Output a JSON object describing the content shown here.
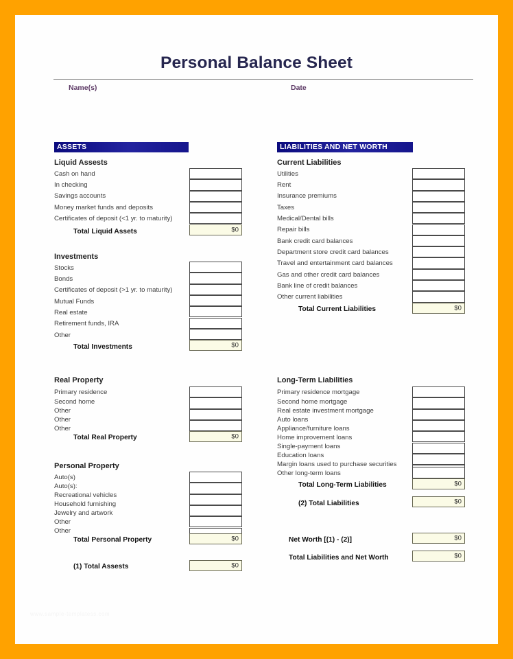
{
  "document": {
    "title": "Personal Balance Sheet",
    "name_label": "Name(s)",
    "date_label": "Date",
    "watermark": "www.sample-templatess.com"
  },
  "colors": {
    "border": "#ffa200",
    "banner": "#11118f",
    "title_text": "#26264f",
    "meta_text": "#5d3a66",
    "total_fill": "#fbfbe6"
  },
  "assets": {
    "banner": "ASSETS",
    "sections": [
      {
        "heading": "Liquid Assests",
        "rows": [
          "Cash on hand",
          "In checking",
          "Savings accounts",
          "Money market funds and deposits",
          "Certificates of deposit (<1 yr. to maturity)"
        ],
        "total_label": "Total Liquid Assets",
        "total_value": "$0"
      },
      {
        "heading": "Investments",
        "rows": [
          "Stocks",
          "Bonds",
          "Certificates of deposit (>1 yr. to maturity)",
          "Mutual Funds",
          "Real estate",
          "Retirement funds, IRA",
          "Other"
        ],
        "total_label": "Total Investments",
        "total_value": "$0"
      },
      {
        "heading": "Real Property",
        "rows": [
          "Primary residence",
          "Second home",
          "Other",
          "Other",
          "Other"
        ],
        "total_label": "Total Real Property",
        "total_value": "$0"
      },
      {
        "heading": "Personal Property",
        "rows": [
          "Auto(s)",
          "Auto(s):",
          "Recreational vehicles",
          "Household furnishing",
          "Jewelry and artwork",
          "Other",
          "Other"
        ],
        "total_label": "Total Personal Property",
        "total_value": "$0"
      }
    ],
    "grand_total_label": "(1) Total Assests",
    "grand_total_value": "$0"
  },
  "liabilities": {
    "banner": "LIABILITIES AND NET WORTH",
    "sections": [
      {
        "heading": "Current Liabilities",
        "rows": [
          "Utilities",
          "Rent",
          "Insurance premiums",
          "Taxes",
          "Medical/Dental bills",
          "Repair bills",
          "Bank credit card balances",
          "Department store credit card balances",
          "Travel and entertainment card balances",
          "Gas and other credit card balances",
          "Bank line of credit balances",
          "Other current liabilities"
        ],
        "total_label": "Total Current Liabilities",
        "total_value": "$0"
      },
      {
        "heading": "Long-Term Liabilities",
        "rows": [
          "Primary residence mortgage",
          "Second home mortgage",
          "Real estate investment mortgage",
          "Auto loans",
          "Appliance/furniture loans",
          "Home improvement loans",
          "Single-payment loans",
          "Education loans",
          "Margin loans used to purchase securities",
          "Other long-term loans"
        ],
        "total_label": "Total Long-Term Liabilities",
        "total_value": "$0"
      }
    ],
    "grand_total_label": "(2) Total Liabilities",
    "grand_total_value": "$0",
    "net_worth_label": "Net Worth [(1) - (2)]",
    "net_worth_value": "$0",
    "total_liab_networth_label": "Total Liabilities and Net Worth",
    "total_liab_networth_value": "$0"
  }
}
